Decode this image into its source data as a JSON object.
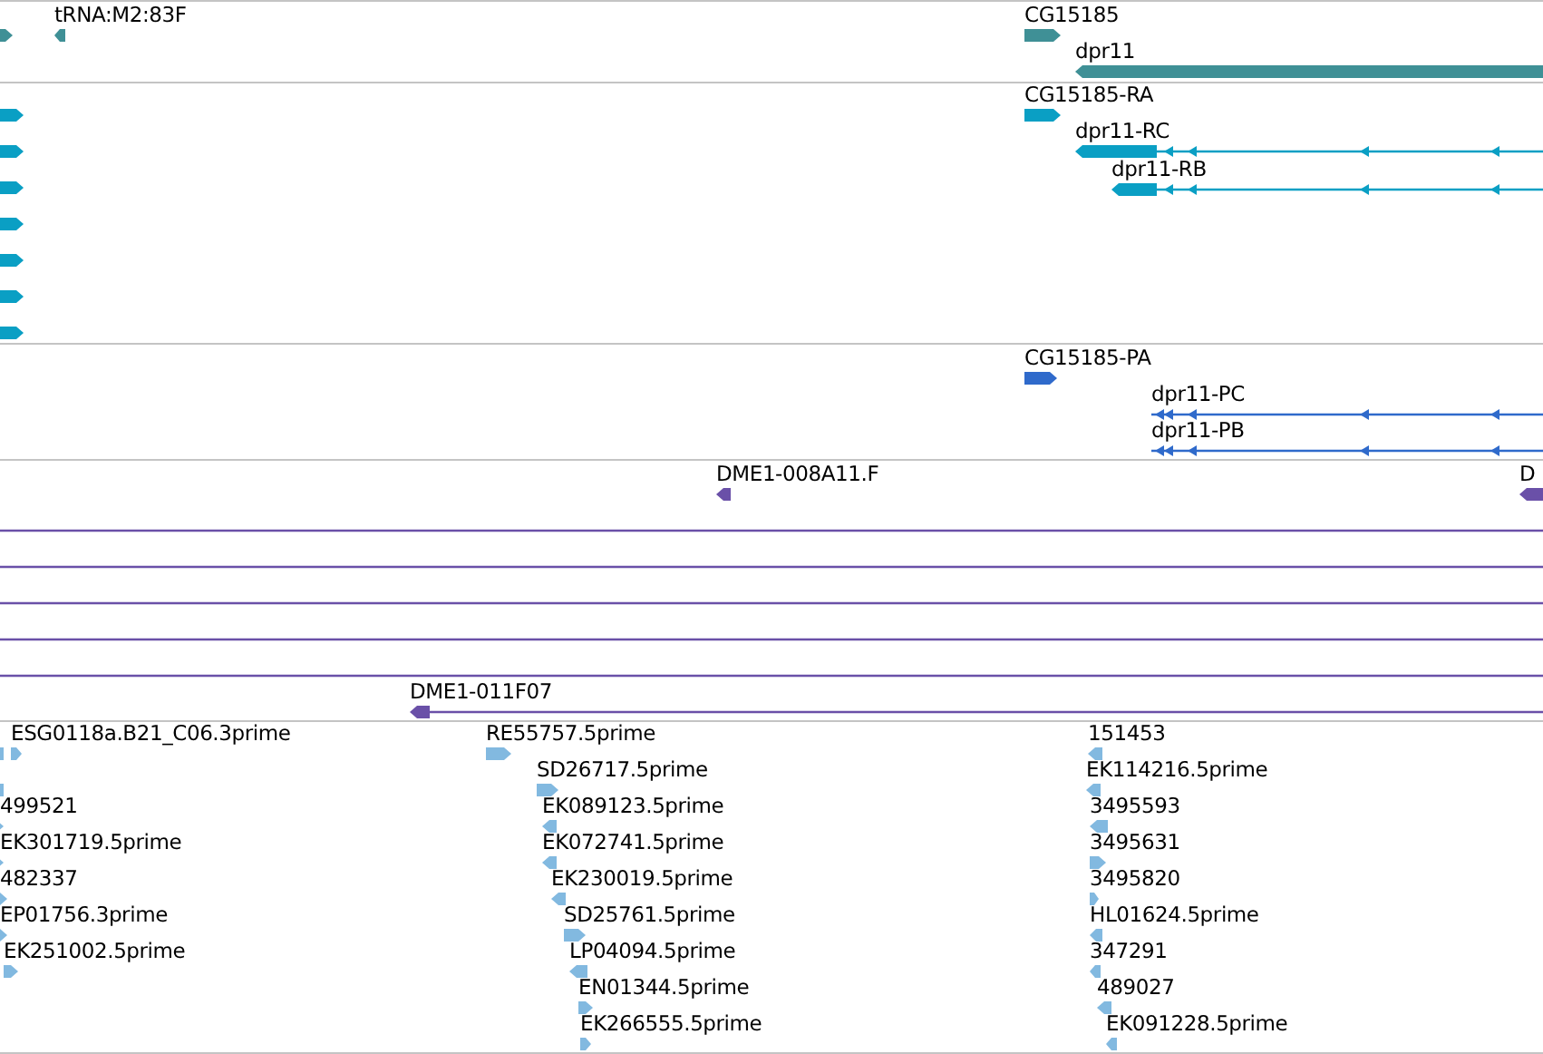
{
  "tracks": [
    {
      "color": "#3f9096",
      "features": [
        {
          "kind": "block",
          "reverse": false
        },
        {
          "label": "tRNA:M2:83F",
          "kind": "block",
          "reverse": true
        },
        {
          "label": "CG15185",
          "kind": "block",
          "reverse": false
        },
        {
          "label": "dpr11",
          "kind": "block",
          "reverse": true
        }
      ]
    },
    {
      "color": "#0a9fc4",
      "features": [
        {
          "kind": "block",
          "reverse": false
        },
        {
          "kind": "block",
          "reverse": false
        },
        {
          "kind": "block",
          "reverse": false
        },
        {
          "kind": "block",
          "reverse": false
        },
        {
          "kind": "block",
          "reverse": false
        },
        {
          "kind": "block",
          "reverse": false
        },
        {
          "kind": "block",
          "reverse": false
        },
        {
          "label": "CG15185-RA",
          "kind": "block",
          "reverse": false
        },
        {
          "label": "dpr11-RC",
          "kind": "transcript",
          "reverse": true
        },
        {
          "label": "dpr11-RB",
          "kind": "transcript",
          "reverse": true
        }
      ]
    },
    {
      "color": "#2f6acb",
      "features": [
        {
          "label": "CG15185-PA",
          "kind": "block",
          "reverse": false
        },
        {
          "label": "dpr11-PC",
          "kind": "transcript",
          "reverse": true
        },
        {
          "label": "dpr11-PB",
          "kind": "transcript",
          "reverse": true
        }
      ]
    },
    {
      "color": "#6a50a8",
      "features": [
        {
          "label": "DME1-008A11.F",
          "kind": "block",
          "reverse": true
        },
        {
          "label": "D",
          "kind": "block",
          "reverse": true
        },
        {
          "kind": "line"
        },
        {
          "kind": "line"
        },
        {
          "kind": "line"
        },
        {
          "kind": "line"
        },
        {
          "kind": "line"
        },
        {
          "label": "DME1-011F07",
          "kind": "transcript",
          "reverse": true
        }
      ]
    },
    {
      "color": "#82b9e0",
      "features": [
        {
          "kind": "block",
          "reverse": true
        },
        {
          "label": "ESG0118a.B21_C06.3prime",
          "kind": "block",
          "reverse": false
        },
        {
          "kind": "block",
          "reverse": true
        },
        {
          "label": "499521",
          "kind": "block",
          "reverse": false
        },
        {
          "label": "EK301719.5prime",
          "kind": "block",
          "reverse": false
        },
        {
          "label": "482337",
          "kind": "block",
          "reverse": false
        },
        {
          "label": "EP01756.3prime",
          "kind": "block",
          "reverse": false
        },
        {
          "label": "EK251002.5prime",
          "kind": "block",
          "reverse": false
        },
        {
          "label": "RE55757.5prime",
          "kind": "block",
          "reverse": false
        },
        {
          "label": "SD26717.5prime",
          "kind": "block",
          "reverse": false
        },
        {
          "label": "EK089123.5prime",
          "kind": "block",
          "reverse": true
        },
        {
          "label": "EK072741.5prime",
          "kind": "block",
          "reverse": true
        },
        {
          "label": "EK230019.5prime",
          "kind": "block",
          "reverse": true
        },
        {
          "label": "SD25761.5prime",
          "kind": "block",
          "reverse": false
        },
        {
          "label": "LP04094.5prime",
          "kind": "block",
          "reverse": true
        },
        {
          "label": "EN01344.5prime",
          "kind": "block",
          "reverse": false
        },
        {
          "label": "EK266555.5prime",
          "kind": "block",
          "reverse": false
        },
        {
          "label": "151453",
          "kind": "block",
          "reverse": true
        },
        {
          "label": "EK114216.5prime",
          "kind": "block",
          "reverse": true
        },
        {
          "label": "3495593",
          "kind": "block",
          "reverse": true
        },
        {
          "label": "3495631",
          "kind": "block",
          "reverse": false
        },
        {
          "label": "3495820",
          "kind": "block",
          "reverse": false
        },
        {
          "label": "HL01624.5prime",
          "kind": "block",
          "reverse": true
        },
        {
          "label": "347291",
          "kind": "block",
          "reverse": true
        },
        {
          "label": "489027",
          "kind": "block",
          "reverse": true
        },
        {
          "label": "EK091228.5prime",
          "kind": "block",
          "reverse": true
        }
      ]
    }
  ]
}
